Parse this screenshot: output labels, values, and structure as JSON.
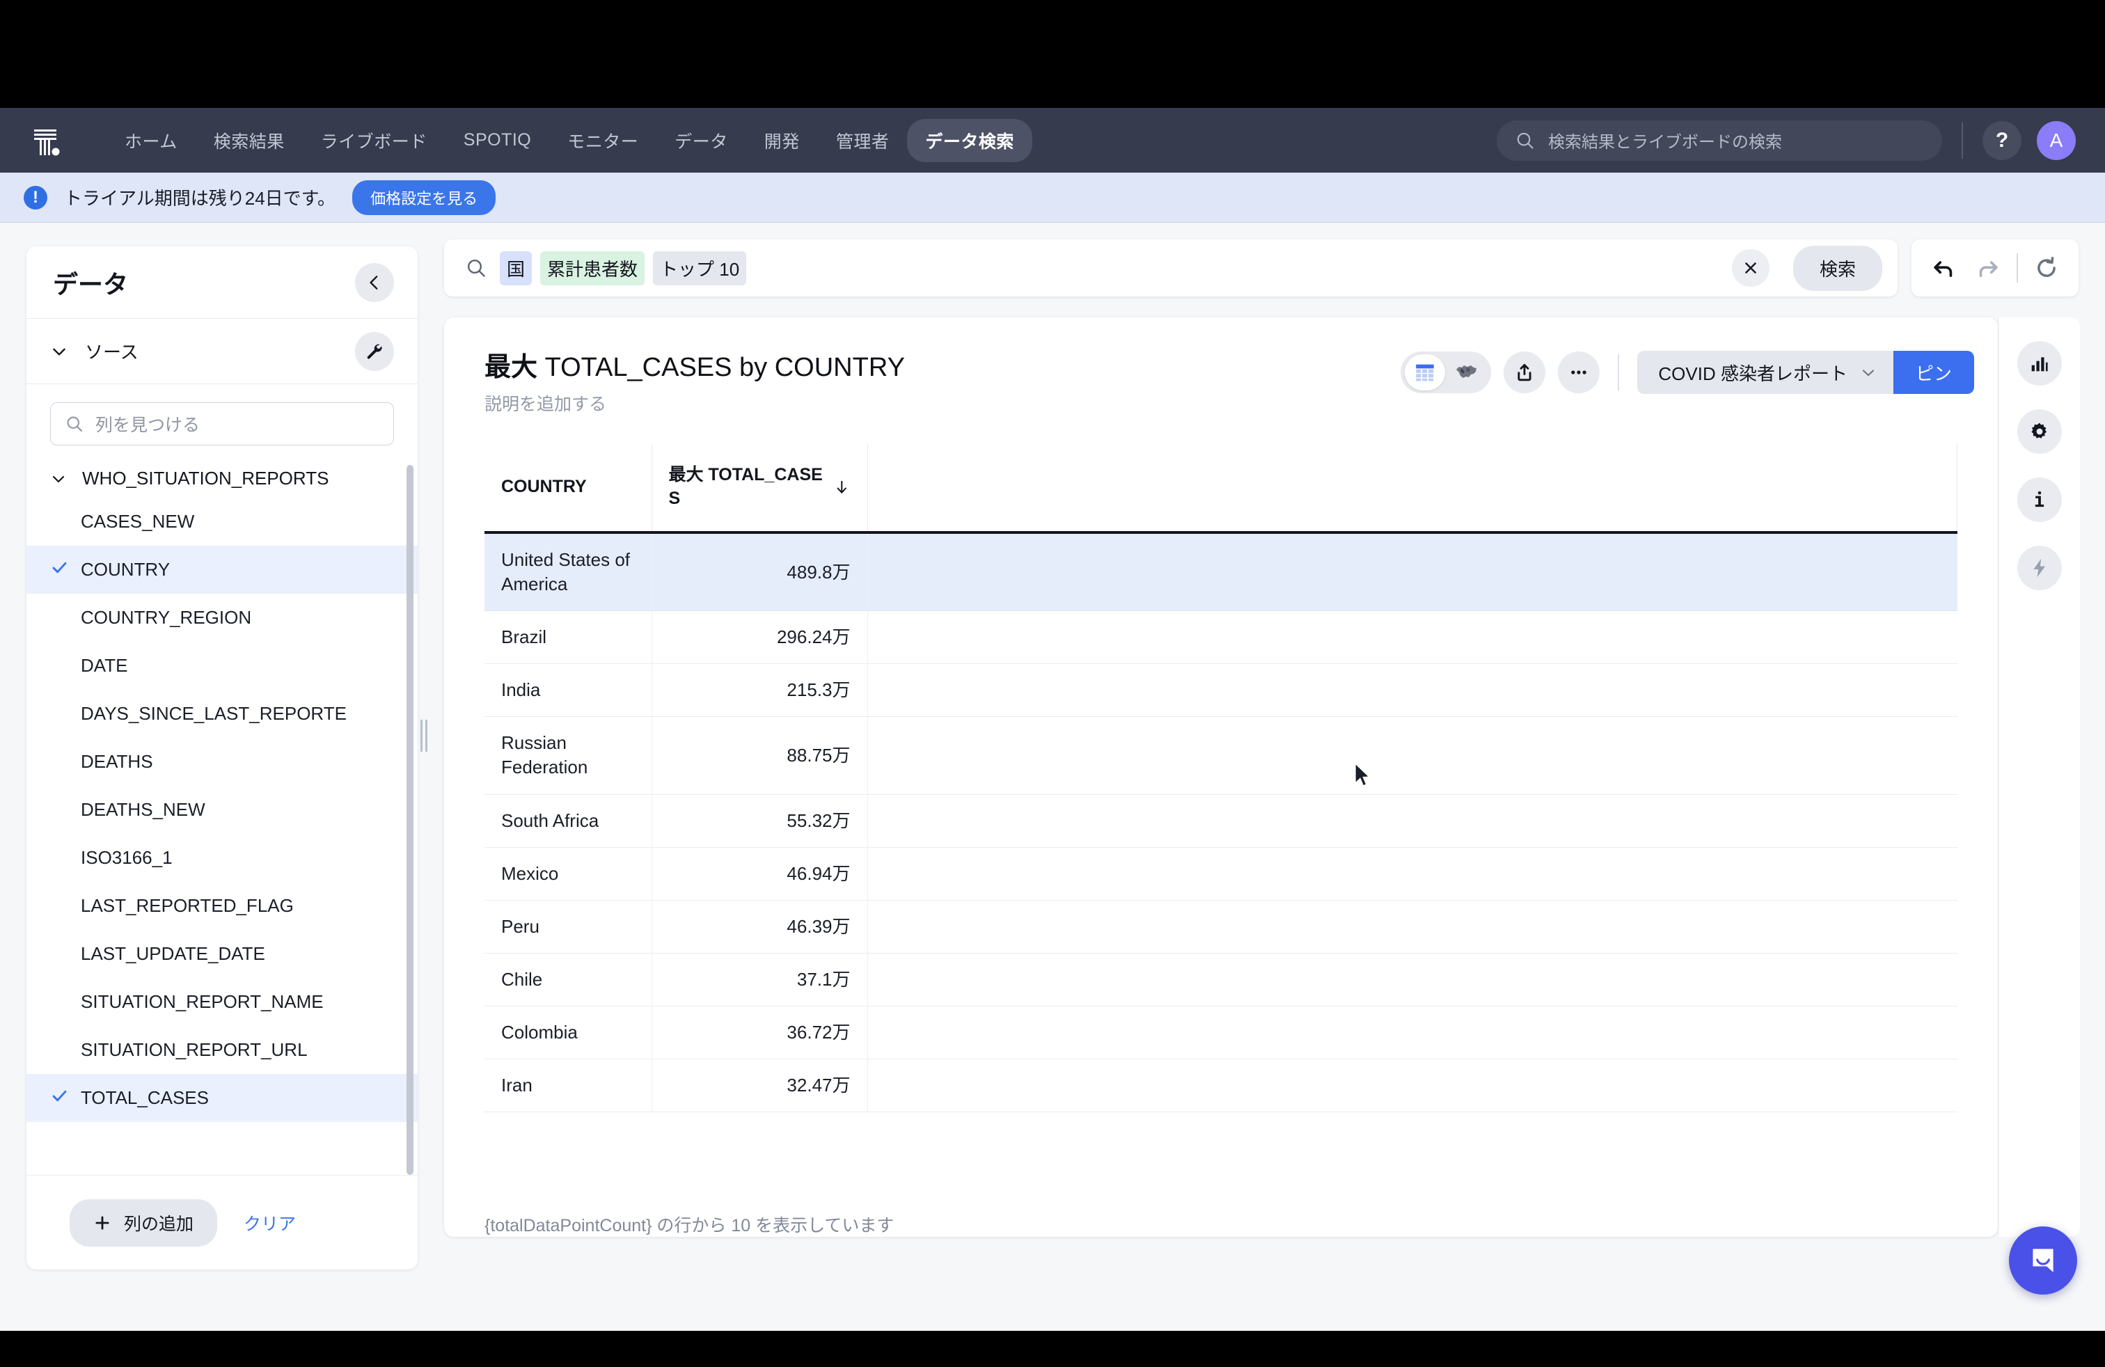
{
  "topnav": {
    "logo_name": "thoughtspot-logo",
    "items": [
      {
        "label": "ホーム",
        "active": false
      },
      {
        "label": "検索結果",
        "active": false
      },
      {
        "label": "ライブボード",
        "active": false
      },
      {
        "label": "SPOTIQ",
        "active": false
      },
      {
        "label": "モニター",
        "active": false
      },
      {
        "label": "データ",
        "active": false
      },
      {
        "label": "開発",
        "active": false
      },
      {
        "label": "管理者",
        "active": false
      },
      {
        "label": "データ検索",
        "active": true
      }
    ],
    "search_placeholder": "検索結果とライブボードの検索",
    "help_label": "?",
    "avatar_initial": "A"
  },
  "banner": {
    "message": "トライアル期間は残り24日です。",
    "cta_label": "価格設定を見る"
  },
  "data_panel": {
    "title": "データ",
    "collapse_icon": "chevron-left-icon",
    "wrench_icon": "wrench-icon",
    "source_label": "ソース",
    "find_column_placeholder": "列を見つける",
    "table_name": "WHO_SITUATION_REPORTS",
    "columns": [
      {
        "name": "CASES_NEW",
        "selected": false
      },
      {
        "name": "COUNTRY",
        "selected": true
      },
      {
        "name": "COUNTRY_REGION",
        "selected": false
      },
      {
        "name": "DATE",
        "selected": false
      },
      {
        "name": "DAYS_SINCE_LAST_REPORTE",
        "selected": false
      },
      {
        "name": "DEATHS",
        "selected": false
      },
      {
        "name": "DEATHS_NEW",
        "selected": false
      },
      {
        "name": "ISO3166_1",
        "selected": false
      },
      {
        "name": "LAST_REPORTED_FLAG",
        "selected": false
      },
      {
        "name": "LAST_UPDATE_DATE",
        "selected": false
      },
      {
        "name": "SITUATION_REPORT_NAME",
        "selected": false
      },
      {
        "name": "SITUATION_REPORT_URL",
        "selected": false
      },
      {
        "name": "TOTAL_CASES",
        "selected": true
      }
    ],
    "add_column_label": "列の追加",
    "clear_label": "クリア"
  },
  "search": {
    "tokens": [
      {
        "text": "国",
        "kind": "attr"
      },
      {
        "text": "累計患者数",
        "kind": "measure"
      },
      {
        "text": "トップ 10",
        "kind": "mod"
      }
    ],
    "clear_icon": "close-icon",
    "go_label": "検索",
    "undo_icon": "undo-icon",
    "redo_icon": "redo-icon",
    "reset_icon": "reset-icon"
  },
  "answer": {
    "title_prefix": "最大",
    "title_rest": "TOTAL_CASES by COUNTRY",
    "description_placeholder": "説明を追加する",
    "viz_table_icon": "table-view-icon",
    "viz_geo_icon": "geo-map-icon",
    "share_icon": "share-icon",
    "more_icon": "more-options-icon",
    "liveboard_name": "COVID 感染者レポート",
    "liveboard_caret": "chevron-down-icon",
    "pin_label": "ピン",
    "footer_text": "{totalDataPointCount} の行から 10 を表示しています"
  },
  "chart_data": {
    "type": "table",
    "title": "最大 TOTAL_CASES by COUNTRY",
    "columns": [
      "COUNTRY",
      "最大 TOTAL_CASES"
    ],
    "sort": {
      "column": "最大 TOTAL_CASES",
      "direction": "desc",
      "icon": "arrow-down-icon"
    },
    "categories": [
      "United States of America",
      "Brazil",
      "India",
      "Russian Federation",
      "South Africa",
      "Mexico",
      "Peru",
      "Chile",
      "Colombia",
      "Iran"
    ],
    "values": [
      4898000,
      2962400,
      2153000,
      887500,
      553200,
      469400,
      463900,
      371000,
      367200,
      324700
    ],
    "value_labels": [
      "489.8万",
      "296.24万",
      "215.3万",
      "88.75万",
      "55.32万",
      "46.94万",
      "46.39万",
      "37.1万",
      "36.72万",
      "32.47万"
    ],
    "rows": [
      {
        "country": "United States of America",
        "value": "489.8万",
        "highlighted": true
      },
      {
        "country": "Brazil",
        "value": "296.24万",
        "highlighted": false
      },
      {
        "country": "India",
        "value": "215.3万",
        "highlighted": false
      },
      {
        "country": "Russian Federation",
        "value": "88.75万",
        "highlighted": false
      },
      {
        "country": "South Africa",
        "value": "55.32万",
        "highlighted": false
      },
      {
        "country": "Mexico",
        "value": "46.94万",
        "highlighted": false
      },
      {
        "country": "Peru",
        "value": "46.39万",
        "highlighted": false
      },
      {
        "country": "Chile",
        "value": "37.1万",
        "highlighted": false
      },
      {
        "country": "Colombia",
        "value": "36.72万",
        "highlighted": false
      },
      {
        "country": "Iran",
        "value": "32.47万",
        "highlighted": false
      }
    ]
  },
  "rail": {
    "items": [
      {
        "icon": "bar-chart-icon",
        "name": "chart-config"
      },
      {
        "icon": "gear-icon",
        "name": "settings"
      },
      {
        "icon": "info-icon",
        "name": "info"
      },
      {
        "icon": "lightning-icon",
        "name": "spotiq-insights"
      }
    ]
  },
  "chat": {
    "icon": "chat-bubble-icon"
  },
  "colors": {
    "nav_bg": "#363b4e",
    "accent_blue": "#3b6ff0",
    "banner_bg": "#dfe6f7",
    "highlight_row": "#e6edfa",
    "token_attr": "#d8e1fb",
    "token_measure": "#d9f2e1",
    "chat_purple": "#4a51e8"
  }
}
